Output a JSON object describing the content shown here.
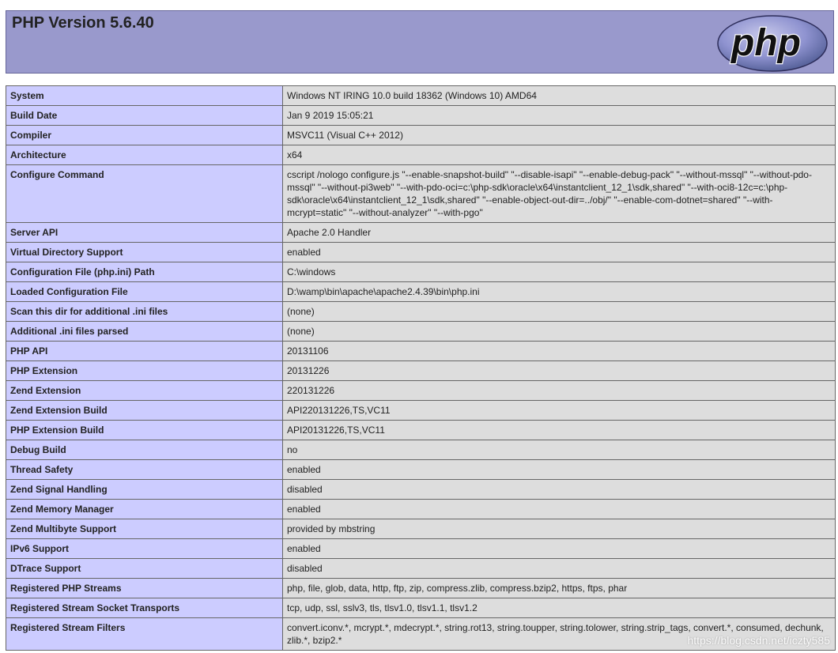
{
  "header": {
    "title": "PHP Version 5.6.40",
    "logo_icon": "php-logo-icon"
  },
  "rows": [
    {
      "key": "System",
      "value": "Windows NT IRING 10.0 build 18362 (Windows 10) AMD64"
    },
    {
      "key": "Build Date",
      "value": "Jan 9 2019 15:05:21"
    },
    {
      "key": "Compiler",
      "value": "MSVC11 (Visual C++ 2012)"
    },
    {
      "key": "Architecture",
      "value": "x64"
    },
    {
      "key": "Configure Command",
      "value": "cscript /nologo configure.js \"--enable-snapshot-build\" \"--disable-isapi\" \"--enable-debug-pack\" \"--without-mssql\" \"--without-pdo-mssql\" \"--without-pi3web\" \"--with-pdo-oci=c:\\php-sdk\\oracle\\x64\\instantclient_12_1\\sdk,shared\" \"--with-oci8-12c=c:\\php-sdk\\oracle\\x64\\instantclient_12_1\\sdk,shared\" \"--enable-object-out-dir=../obj/\" \"--enable-com-dotnet=shared\" \"--with-mcrypt=static\" \"--without-analyzer\" \"--with-pgo\""
    },
    {
      "key": "Server API",
      "value": "Apache 2.0 Handler"
    },
    {
      "key": "Virtual Directory Support",
      "value": "enabled"
    },
    {
      "key": "Configuration File (php.ini) Path",
      "value": "C:\\windows"
    },
    {
      "key": "Loaded Configuration File",
      "value": "D:\\wamp\\bin\\apache\\apache2.4.39\\bin\\php.ini"
    },
    {
      "key": "Scan this dir for additional .ini files",
      "value": "(none)"
    },
    {
      "key": "Additional .ini files parsed",
      "value": "(none)"
    },
    {
      "key": "PHP API",
      "value": "20131106"
    },
    {
      "key": "PHP Extension",
      "value": "20131226"
    },
    {
      "key": "Zend Extension",
      "value": "220131226"
    },
    {
      "key": "Zend Extension Build",
      "value": "API220131226,TS,VC11"
    },
    {
      "key": "PHP Extension Build",
      "value": "API20131226,TS,VC11"
    },
    {
      "key": "Debug Build",
      "value": "no"
    },
    {
      "key": "Thread Safety",
      "value": "enabled"
    },
    {
      "key": "Zend Signal Handling",
      "value": "disabled"
    },
    {
      "key": "Zend Memory Manager",
      "value": "enabled"
    },
    {
      "key": "Zend Multibyte Support",
      "value": "provided by mbstring"
    },
    {
      "key": "IPv6 Support",
      "value": "enabled"
    },
    {
      "key": "DTrace Support",
      "value": "disabled"
    },
    {
      "key": "Registered PHP Streams",
      "value": "php, file, glob, data, http, ftp, zip, compress.zlib, compress.bzip2, https, ftps, phar"
    },
    {
      "key": "Registered Stream Socket Transports",
      "value": "tcp, udp, ssl, sslv3, tls, tlsv1.0, tlsv1.1, tlsv1.2"
    },
    {
      "key": "Registered Stream Filters",
      "value": "convert.iconv.*, mcrypt.*, mdecrypt.*, string.rot13, string.toupper, string.tolower, string.strip_tags, convert.*, consumed, dechunk, zlib.*, bzip2.*"
    }
  ],
  "watermark": "https://blog.csdn.net/iczty585",
  "colors": {
    "header_bg": "#9999cc",
    "key_bg": "#ccccff",
    "value_bg": "#dddddd",
    "border": "#666666"
  }
}
